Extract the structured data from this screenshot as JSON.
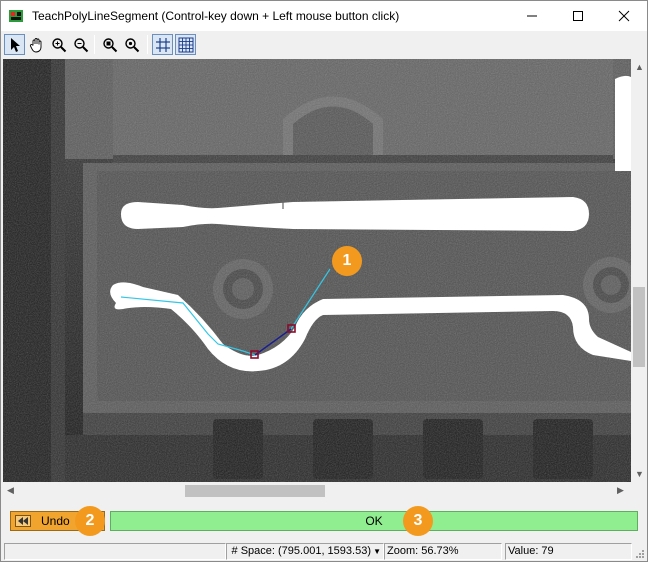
{
  "window": {
    "title": "TeachPolyLineSegment (Control-key down + Left mouse button click)"
  },
  "toolbar": {
    "tools": [
      "pointer-tool",
      "pan-tool",
      "zoom-in-tool",
      "zoom-out-tool",
      "zoom-region-tool",
      "zoom-fit-tool",
      "grid-tool",
      "fine-grid-tool"
    ]
  },
  "callouts": {
    "one": "1",
    "two": "2",
    "three": "3"
  },
  "buttons": {
    "undo": "Undo",
    "ok": "OK"
  },
  "status": {
    "space": "# Space: (795.001, 1593.53)",
    "zoom": "Zoom: 56.73%",
    "value": "Value: 79"
  },
  "colors": {
    "undo": "#f2a52e",
    "ok": "#90ee90",
    "callout": "#f39a1e",
    "polyline": "#33c7e6",
    "segment": "#1c1c8c",
    "vertex": "#8b0a2a"
  }
}
